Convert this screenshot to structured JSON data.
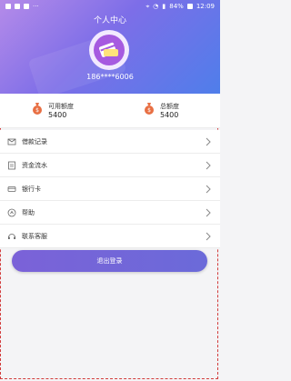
{
  "status_bar": {
    "battery": "84%",
    "time": "12:09",
    "dots": "···"
  },
  "header": {
    "title": "个人中心",
    "phone": "186****6006"
  },
  "balances": {
    "available_label": "可用额度",
    "available_value": "5400",
    "total_label": "总额度",
    "total_value": "5400"
  },
  "menu": {
    "items": [
      {
        "label": "借款记录",
        "icon": "envelope-icon"
      },
      {
        "label": "资金流水",
        "icon": "ledger-icon"
      },
      {
        "label": "银行卡",
        "icon": "card-icon"
      },
      {
        "label": "帮助",
        "icon": "help-icon"
      },
      {
        "label": "联系客服",
        "icon": "headset-icon"
      }
    ]
  },
  "logout": {
    "label": "退出登录"
  },
  "colors": {
    "header_gradient_start": "#b58be9",
    "header_gradient_end": "#4f7eea",
    "button": "#6b6ad9",
    "money_bag": "#e86f43"
  }
}
